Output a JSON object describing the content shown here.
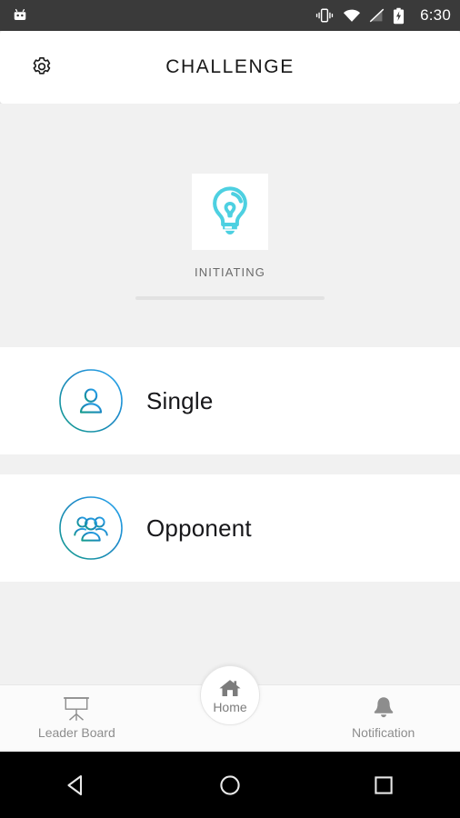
{
  "statusbar": {
    "time": "6:30",
    "icons": [
      {
        "name": "android-robot-icon"
      },
      {
        "name": "vibrate-icon"
      },
      {
        "name": "wifi-icon"
      },
      {
        "name": "signal-off-icon"
      },
      {
        "name": "battery-charging-icon"
      }
    ],
    "background_color": "#3a3a3a"
  },
  "appbar": {
    "title": "CHALLENGE",
    "settings_icon": "gear-icon",
    "background_color": "#ffffff"
  },
  "hero": {
    "icon": "lightbulb-icon",
    "icon_color": "#4DD0E1",
    "label": "INITIATING",
    "progress_color": "#e2e2e2"
  },
  "modes": [
    {
      "label": "Single",
      "icon": "person-icon",
      "gradient_from": "#1a9e8f",
      "gradient_to": "#2196f3"
    },
    {
      "label": "Opponent",
      "icon": "people-group-icon",
      "gradient_from": "#1a9e8f",
      "gradient_to": "#2196f3"
    }
  ],
  "tabbar": {
    "items": [
      {
        "label": "Leader Board",
        "icon": "presentation-board-icon"
      },
      {
        "label": "Home",
        "icon": "home-icon"
      },
      {
        "label": "Notification",
        "icon": "bell-icon"
      }
    ],
    "active": "Home",
    "icon_color": "#8d8d8d"
  },
  "navbar": {
    "buttons": [
      {
        "label": "Back",
        "icon": "triangle-back-icon"
      },
      {
        "label": "Home",
        "icon": "circle-home-icon"
      },
      {
        "label": "Recents",
        "icon": "square-recents-icon"
      }
    ],
    "background_color": "#000000"
  }
}
